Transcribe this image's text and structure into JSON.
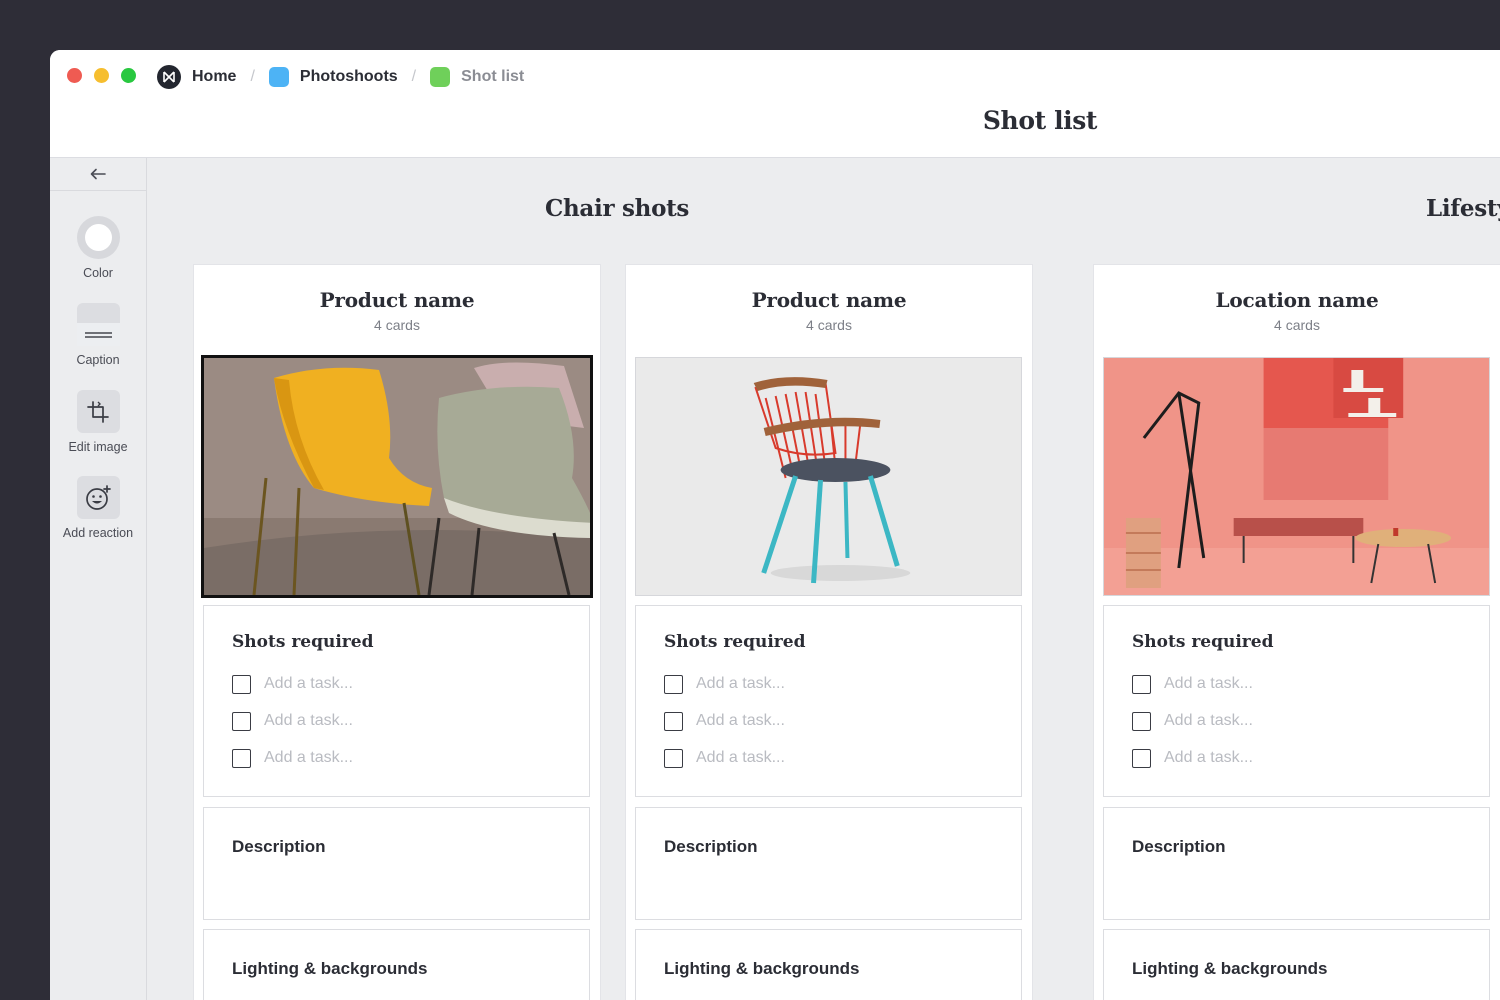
{
  "breadcrumb": [
    {
      "label": "Home",
      "icon": "workspace-logo-icon"
    },
    {
      "label": "Photoshoots",
      "icon": "board-icon",
      "color": "#4db3f5"
    },
    {
      "label": "Shot list",
      "icon": "board-icon",
      "color": "#6fd05a"
    }
  ],
  "page_title": "Shot list",
  "sidebar": {
    "back_icon": "arrow-left-icon",
    "tools": [
      {
        "label": "Color",
        "icon": "color-swatch-icon"
      },
      {
        "label": "Caption",
        "icon": "caption-icon"
      },
      {
        "label": "Edit image",
        "icon": "crop-icon"
      },
      {
        "label": "Add reaction",
        "icon": "add-reaction-icon"
      }
    ]
  },
  "groups": [
    {
      "title": "Chair shots"
    },
    {
      "title": "Lifesty"
    }
  ],
  "columns": [
    {
      "title": "Product name",
      "count": "4 cards",
      "image": "yellow and grey chairs photo",
      "shots_title": "Shots required",
      "tasks": [
        "Add a task...",
        "Add a task...",
        "Add a task..."
      ],
      "description_title": "Description",
      "lighting_title": "Lighting & backgrounds"
    },
    {
      "title": "Product name",
      "count": "4 cards",
      "image": "red windsor chair photo",
      "shots_title": "Shots required",
      "tasks": [
        "Add a task...",
        "Add a task...",
        "Add a task..."
      ],
      "description_title": "Description",
      "lighting_title": "Lighting & backgrounds"
    },
    {
      "title": "Location name",
      "count": "4 cards",
      "image": "pink interior photo",
      "shots_title": "Shots required",
      "tasks": [
        "Add a task...",
        "Add a task...",
        "Add a task..."
      ],
      "description_title": "Description",
      "lighting_title": "Lighting & backgrounds"
    }
  ],
  "colors": {
    "background": "#2e2d37",
    "canvas": "#ecedef",
    "selected_border": "#111111"
  }
}
